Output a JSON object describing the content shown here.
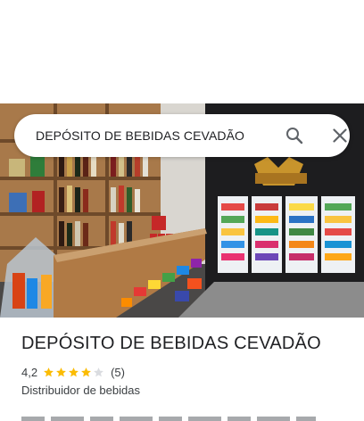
{
  "search": {
    "query": "DEPÓSITO DE BEBIDAS CEVADÃO"
  },
  "icons": {
    "search": "search-icon",
    "close": "close-icon"
  },
  "place": {
    "name": "DEPÓSITO DE BEBIDAS CEVADÃO",
    "rating": "4,2",
    "rating_fraction": 0.84,
    "stars_filled": 4,
    "stars_total": 5,
    "reviews": "(5)",
    "category": "Distribuidor de bebidas"
  },
  "colors": {
    "star_filled": "#fbbc04",
    "star_empty": "#dadce0",
    "text_primary": "#202124",
    "text_secondary": "#3c4043"
  }
}
